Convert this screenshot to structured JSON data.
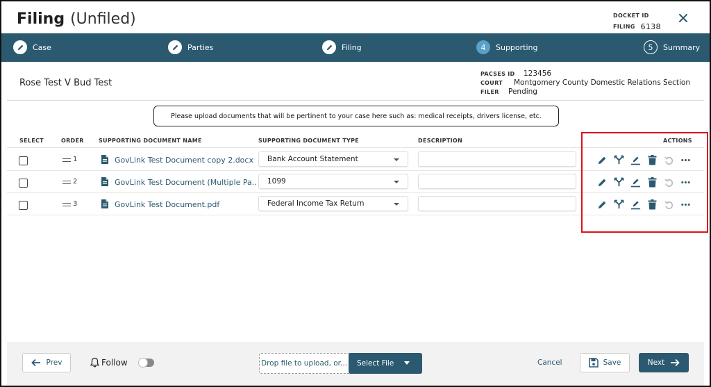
{
  "header": {
    "title": "Filing",
    "subtitle": "(Unfiled)",
    "docket_label": "DOCKET ID",
    "docket_value": "",
    "filing_label": "FILING",
    "filing_value": "6138"
  },
  "steps": [
    {
      "label": "Case",
      "state": "done"
    },
    {
      "label": "Parties",
      "state": "done"
    },
    {
      "label": "Filing",
      "state": "done"
    },
    {
      "label": "Supporting",
      "state": "current",
      "number": "4"
    },
    {
      "label": "Summary",
      "state": "future",
      "number": "5"
    }
  ],
  "case": {
    "name": "Rose Test V Bud Test",
    "pacses_label": "PACSES ID",
    "pacses_value": "123456",
    "court_label": "COURT",
    "court_value": "Montgomery County Domestic Relations Section",
    "filer_label": "FILER",
    "filer_value": "Pending"
  },
  "notice": "Please upload documents that will be pertinent to your case here such as: medical receipts, drivers license, etc.",
  "table": {
    "headers": {
      "select": "SELECT",
      "order": "ORDER",
      "name": "SUPPORTING DOCUMENT NAME",
      "type": "SUPPORTING DOCUMENT TYPE",
      "description": "DESCRIPTION",
      "actions": "ACTIONS"
    },
    "rows": [
      {
        "order": "1",
        "name": "GovLink Test Document copy 2.docx",
        "type": "Bank Account Statement",
        "description": ""
      },
      {
        "order": "2",
        "name": "GovLink Test Document (Multiple Pa...",
        "type": "1099",
        "description": ""
      },
      {
        "order": "3",
        "name": "GovLink Test Document.pdf",
        "type": "Federal Income Tax Return",
        "description": ""
      }
    ]
  },
  "footer": {
    "prev": "Prev",
    "follow": "Follow",
    "follow_on": false,
    "drop_text": "Drop file to upload, or...",
    "select_file": "Select File",
    "cancel": "Cancel",
    "save": "Save",
    "next": "Next"
  },
  "colors": {
    "brand": "#2b5a70",
    "highlight_box": "#d9141b"
  }
}
